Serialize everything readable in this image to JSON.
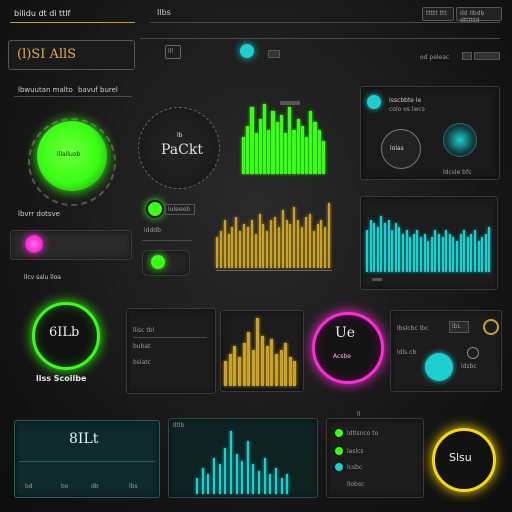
{
  "header": {
    "title": "bilidu dt di ttlf",
    "center_label": "Ilbs",
    "right_button_1": "ttttt ttt",
    "right_button_2": "dd ilbdb dtttttd"
  },
  "toolbar": {
    "brand": "(l)SI AllS",
    "item_icon_label": "lll",
    "right_small": "od peleac"
  },
  "section_labels": {
    "left_header": "lbwuutan malto",
    "left_header_2": "bavuf burel",
    "left_mid": "lbvrr dotsve",
    "left_low": "llcv salu lloa"
  },
  "gauges": {
    "green_gauge_label": "lllalluob",
    "dial_label": "PaCkt",
    "dial_small": "lb",
    "left_ring_label": "6ILb",
    "left_ring_caption": "llss Scoilbe",
    "magenta_ring_label": "Ue",
    "magenta_ring_sub": "Acsbe",
    "yellow_ring_label": "Slsu"
  },
  "info_card": {
    "line1": "Isscbbte le",
    "line2": "colo os lwcs",
    "badge_label": "lolas",
    "footer": "ldcsle bfs"
  },
  "mid_controls": {
    "tag1": "luleeeb",
    "tag2": "ldddb"
  },
  "mini_list": {
    "row1": "llisc tbl",
    "row2": "bubat",
    "row3": "bslatc",
    "footer_right": "lb Ill"
  },
  "bottom_panel": {
    "title": "Iltlb",
    "big_label": "8ILt",
    "nav1": "bd",
    "nav2": "bo",
    "nav3": "db",
    "nav4": "lbs",
    "list_title": "ll",
    "list_rows": [
      "ldtlsnco to",
      "laslcs",
      "lcsbc",
      "llobsc"
    ]
  },
  "teal_list": {
    "row1": "lbslcbc lbc",
    "row2": "ldls cb",
    "row3": "ldsbc",
    "badge": "lbL"
  },
  "colors": {
    "green": "#39ff14",
    "teal": "#1ecfcf",
    "amber": "#c9a227",
    "magenta": "#ff2bd6",
    "yellow": "#f5d90a"
  },
  "chart_data": [
    {
      "type": "bar",
      "values": [
        0.5,
        0.65,
        0.9,
        0.55,
        0.75,
        0.95,
        0.6,
        0.85,
        0.7,
        0.8,
        0.55,
        0.9,
        0.6,
        0.75,
        0.65,
        0.5,
        0.85,
        0.7,
        0.6,
        0.45
      ]
    },
    {
      "type": "bar",
      "values": [
        0.45,
        0.55,
        0.7,
        0.5,
        0.6,
        0.75,
        0.55,
        0.65,
        0.6,
        0.7,
        0.5,
        0.8,
        0.65,
        0.55,
        0.7,
        0.75,
        0.6,
        0.85,
        0.7,
        0.65,
        0.9,
        0.7,
        0.6,
        0.75,
        0.8,
        0.55,
        0.65,
        0.7,
        0.6,
        0.95
      ]
    },
    {
      "type": "bar",
      "values": [
        0.6,
        0.75,
        0.7,
        0.65,
        0.8,
        0.7,
        0.75,
        0.6,
        0.7,
        0.65,
        0.55,
        0.6,
        0.5,
        0.55,
        0.6,
        0.5,
        0.55,
        0.45,
        0.5,
        0.6,
        0.55,
        0.5,
        0.6,
        0.55,
        0.5,
        0.45,
        0.55,
        0.6,
        0.5,
        0.55,
        0.6,
        0.45,
        0.5,
        0.55,
        0.65
      ]
    },
    {
      "type": "bar",
      "values": [
        0.35,
        0.45,
        0.55,
        0.4,
        0.6,
        0.75,
        0.5,
        0.95,
        0.7,
        0.55,
        0.65,
        0.45,
        0.5,
        0.6,
        0.4,
        0.35
      ]
    },
    {
      "type": "bar",
      "values": [
        0.25,
        0.4,
        0.3,
        0.55,
        0.45,
        0.7,
        0.95,
        0.6,
        0.5,
        0.8,
        0.45,
        0.35,
        0.55,
        0.3,
        0.4,
        0.25,
        0.3
      ]
    }
  ]
}
